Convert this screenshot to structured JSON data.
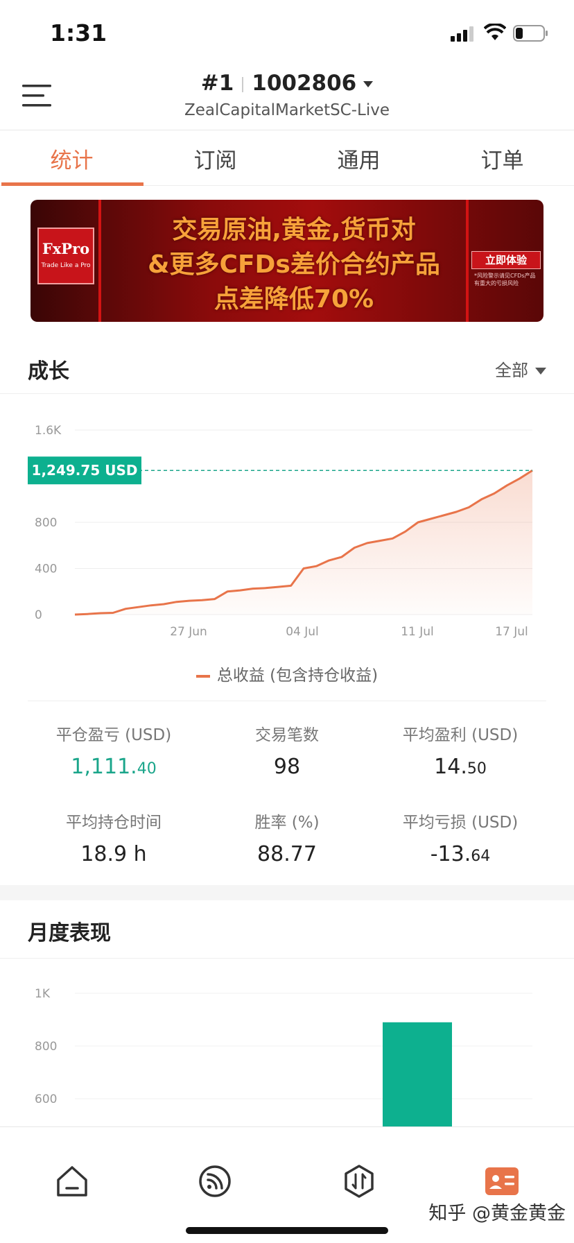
{
  "status": {
    "time": "1:31"
  },
  "header": {
    "rank": "#1",
    "account": "1002806",
    "server": "ZealCapitalMarketSC-Live"
  },
  "tabs": [
    {
      "label": "统计",
      "active": true
    },
    {
      "label": "订阅",
      "active": false
    },
    {
      "label": "通用",
      "active": false
    },
    {
      "label": "订单",
      "active": false
    }
  ],
  "banner": {
    "brand": "FxPro",
    "brand_tag": "Trade Like a Pro",
    "line1": "交易原油,黄金,货币对",
    "line2": "&更多CFDs差价合约产品",
    "line3": "点差降低70%",
    "cta": "立即体验",
    "note": "*风险警示请见CFDs产品有重大的亏损风险"
  },
  "growth": {
    "title": "成长",
    "filter": "全部",
    "legend": "总收益 (包含持仓收益)",
    "current_badge": "1,249.75 USD"
  },
  "chart_data": [
    {
      "type": "area",
      "title": "成长",
      "x_tick_labels": [
        "27 Jun",
        "04 Jul",
        "11 Jul",
        "17 Jul"
      ],
      "y_ticks": [
        0,
        400,
        800,
        "1.6K"
      ],
      "ylim": [
        0,
        1600
      ],
      "series": [
        {
          "name": "总收益 (包含持仓收益)",
          "color": "#e8744a",
          "values": [
            0,
            5,
            12,
            15,
            50,
            65,
            80,
            90,
            110,
            120,
            125,
            135,
            200,
            210,
            225,
            230,
            240,
            250,
            400,
            420,
            470,
            500,
            580,
            620,
            640,
            660,
            720,
            800,
            830,
            860,
            890,
            930,
            1000,
            1050,
            1120,
            1180,
            1249.75
          ]
        }
      ],
      "reference_line": 1249.75,
      "grid": true
    },
    {
      "type": "bar",
      "title": "月度表现",
      "y_ticks": [
        600,
        800,
        "1K"
      ],
      "ylim": [
        600,
        1000
      ],
      "bar_color": "#0db08f",
      "values": [
        890
      ]
    }
  ],
  "stats": [
    {
      "label": "平仓盈亏 (USD)",
      "int": "1,111.",
      "dec": "40",
      "green": true
    },
    {
      "label": "交易笔数",
      "int": "98",
      "dec": "",
      "green": false
    },
    {
      "label": "平均盈利 (USD)",
      "int": "14.",
      "dec": "50",
      "green": false
    },
    {
      "label": "平均持仓时间",
      "int": "18.9 h",
      "dec": "",
      "green": false
    },
    {
      "label": "胜率 (%)",
      "int": "88.77",
      "dec": "",
      "green": false
    },
    {
      "label": "平均亏损 (USD)",
      "int": "-13.",
      "dec": "64",
      "green": false
    }
  ],
  "monthly": {
    "title": "月度表现"
  },
  "bottom_nav": [
    {
      "icon": "home-icon"
    },
    {
      "icon": "feed-icon"
    },
    {
      "icon": "trade-icon"
    },
    {
      "icon": "profile-card-icon",
      "active": true
    }
  ],
  "watermark": "知乎 @黄金黄金"
}
